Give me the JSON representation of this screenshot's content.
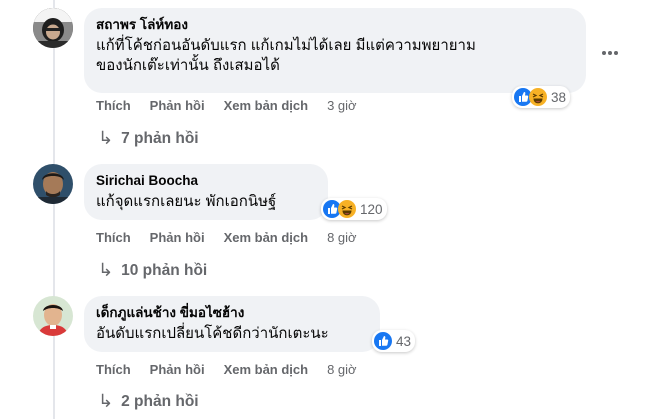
{
  "colors": {
    "bubble": "#f0f2f5",
    "meta_text": "#65676b",
    "like_blue": "#1877f2",
    "haha_yellow": "#f7b125"
  },
  "comments": [
    {
      "author": "สถาพร โล่ห์ทอง",
      "text": "แก้ที่โค้ชก่อนอันดับแรก แก้เกมไม่ได้เลย มีแต่ความพยายาม\nของนักเต๊ะเท่านั้น ถึงเสมอได้",
      "actions": {
        "like": "Thích",
        "reply": "Phản hồi",
        "translate": "Xem bản dịch"
      },
      "time": "3 giờ",
      "reactions": {
        "icons": [
          "like-icon",
          "haha-icon"
        ],
        "count": "38"
      },
      "replies": "7 phản hồi",
      "more_icon": "more-options-icon"
    },
    {
      "author": "Sirichai Boocha",
      "text": "แก้จุดแรกเลยนะ พักเอกนิษฐ์",
      "actions": {
        "like": "Thích",
        "reply": "Phản hồi",
        "translate": "Xem bản dịch"
      },
      "time": "8 giờ",
      "reactions": {
        "icons": [
          "like-icon",
          "haha-icon"
        ],
        "count": "120"
      },
      "replies": "10 phản hồi"
    },
    {
      "author": "เด็กภูแล่นช้าง ขี่มอไซฮ้าง",
      "text": "อันดับแรกเปลี่ยนโค้ชดีกว่านักเตะนะ",
      "actions": {
        "like": "Thích",
        "reply": "Phản hồi",
        "translate": "Xem bản dịch"
      },
      "time": "8 giờ",
      "reactions": {
        "icons": [
          "like-icon"
        ],
        "count": "43"
      },
      "replies": "2 phản hồi"
    }
  ]
}
